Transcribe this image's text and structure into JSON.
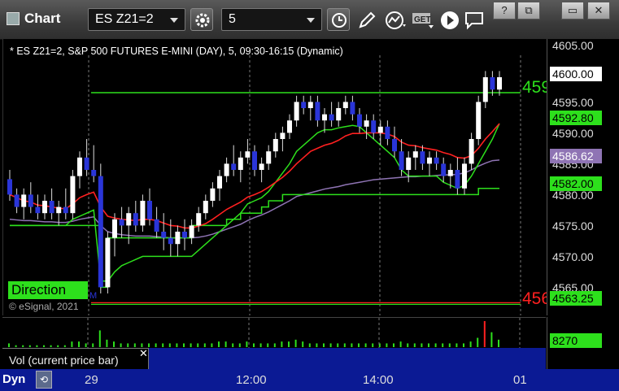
{
  "toolbar": {
    "title": "Chart",
    "symbol": "ES Z21=2",
    "interval": "5",
    "window_buttons": [
      "?",
      "⧉",
      "▭",
      "✕"
    ],
    "icons": [
      "gear-icon",
      "clock-icon",
      "pencil-icon",
      "study-icon",
      "get-icon",
      "play-icon",
      "chat-icon"
    ]
  },
  "chart": {
    "header": "* ES Z21=2, S&P 500 FUTURES E-MINI (DAY), 5, 09:30-16:15 (Dynamic)",
    "copyright": "© eSignal, 2021",
    "direction_label": "Direction",
    "small_marker": "M",
    "green_line_label": "459",
    "red_line_label": "456"
  },
  "price_axis": {
    "ticks": [
      "4605.00",
      "4600.00",
      "4595.00",
      "4590.00",
      "4585.00",
      "4580.00",
      "4575.00",
      "4570.00",
      "4565.00"
    ],
    "tags": [
      {
        "text": "4600.00",
        "bg": "#ffffff",
        "fg": "#000000"
      },
      {
        "text": "4592.80",
        "bg": "#2de01c",
        "fg": "#000000"
      },
      {
        "text": "4586.62",
        "bg": "#8f74b4",
        "fg": "#ffffff"
      },
      {
        "text": "4582.00",
        "bg": "#2de01c",
        "fg": "#000000"
      },
      {
        "text": "4563.25",
        "bg": "#2de01c",
        "fg": "#000000"
      }
    ]
  },
  "volume": {
    "label": "Vol (current price bar)",
    "close_glyph": "✕",
    "value": "8270"
  },
  "time_axis": {
    "ticks": [
      "29",
      "12:00",
      "14:00",
      "01"
    ],
    "dyn_label": "Dyn"
  },
  "colors": {
    "up": "#ffffff",
    "down": "#2a35d8",
    "ema": "#ff2020",
    "band": "#2de01c",
    "vwap": "#8f74b4",
    "level": "#2de01c"
  },
  "chart_data": {
    "type": "candlestick",
    "ylim": [
      4563,
      4606
    ],
    "levels": [
      4597.5,
      4563.5
    ],
    "candles": [
      [
        4583.5,
        4585,
        4580,
        4581
      ],
      [
        4581,
        4582,
        4578,
        4579
      ],
      [
        4579,
        4582,
        4577,
        4581
      ],
      [
        4581,
        4583,
        4578,
        4579
      ],
      [
        4579,
        4581,
        4577,
        4578
      ],
      [
        4578,
        4581,
        4577,
        4580
      ],
      [
        4580,
        4582,
        4577,
        4578
      ],
      [
        4578,
        4580,
        4576,
        4579
      ],
      [
        4579,
        4582,
        4577,
        4578
      ],
      [
        4578,
        4585,
        4577,
        4584
      ],
      [
        4584,
        4588,
        4582,
        4587
      ],
      [
        4587,
        4590,
        4584,
        4585
      ],
      [
        4585,
        4589,
        4583,
        4584
      ],
      [
        4584,
        4586,
        4565,
        4566
      ],
      [
        4566,
        4575,
        4565,
        4574
      ],
      [
        4574,
        4578,
        4571,
        4577
      ],
      [
        4577,
        4579,
        4574,
        4576
      ],
      [
        4576,
        4579,
        4573,
        4578
      ],
      [
        4578,
        4580,
        4575,
        4576
      ],
      [
        4576,
        4581,
        4575,
        4580
      ],
      [
        4580,
        4582,
        4576,
        4577
      ],
      [
        4577,
        4579,
        4574,
        4575
      ],
      [
        4575,
        4578,
        4572,
        4574
      ],
      [
        4574,
        4577,
        4571,
        4573
      ],
      [
        4573,
        4576,
        4571,
        4575
      ],
      [
        4575,
        4577,
        4572,
        4574
      ],
      [
        4574,
        4577,
        4573,
        4576
      ],
      [
        4576,
        4579,
        4575,
        4578
      ],
      [
        4578,
        4581,
        4577,
        4580
      ],
      [
        4580,
        4583,
        4579,
        4582
      ],
      [
        4582,
        4585,
        4580,
        4584
      ],
      [
        4584,
        4587,
        4583,
        4586
      ],
      [
        4586,
        4589,
        4584,
        4585
      ],
      [
        4585,
        4588,
        4583,
        4587
      ],
      [
        4587,
        4590,
        4586,
        4588
      ],
      [
        4588,
        4589,
        4584,
        4585
      ],
      [
        4585,
        4587,
        4583,
        4586
      ],
      [
        4586,
        4589,
        4585,
        4588
      ],
      [
        4588,
        4591,
        4587,
        4590
      ],
      [
        4590,
        4592,
        4588,
        4591
      ],
      [
        4591,
        4594,
        4590,
        4593
      ],
      [
        4593,
        4597,
        4592,
        4596
      ],
      [
        4596,
        4597,
        4594,
        4595
      ],
      [
        4595,
        4597,
        4593,
        4596
      ],
      [
        4596,
        4597,
        4592,
        4593
      ],
      [
        4593,
        4595,
        4591,
        4594
      ],
      [
        4594,
        4596,
        4592,
        4593
      ],
      [
        4593,
        4596,
        4592,
        4595
      ],
      [
        4595,
        4597,
        4594,
        4596
      ],
      [
        4596,
        4597,
        4593,
        4594
      ],
      [
        4594,
        4595,
        4591,
        4592
      ],
      [
        4592,
        4594,
        4590,
        4593
      ],
      [
        4593,
        4594,
        4590,
        4591
      ],
      [
        4591,
        4593,
        4589,
        4592
      ],
      [
        4592,
        4593,
        4589,
        4590
      ],
      [
        4590,
        4592,
        4587,
        4588
      ],
      [
        4588,
        4590,
        4584,
        4585
      ],
      [
        4585,
        4588,
        4583,
        4587
      ],
      [
        4587,
        4589,
        4585,
        4588
      ],
      [
        4588,
        4589,
        4585,
        4586
      ],
      [
        4586,
        4588,
        4584,
        4587
      ],
      [
        4587,
        4588,
        4585,
        4586
      ],
      [
        4586,
        4587,
        4583,
        4584
      ],
      [
        4584,
        4586,
        4582,
        4585
      ],
      [
        4585,
        4587,
        4581,
        4582
      ],
      [
        4582,
        4587,
        4581,
        4586
      ],
      [
        4586,
        4591,
        4585,
        4590
      ],
      [
        4590,
        4597,
        4589,
        4596
      ],
      [
        4596,
        4601,
        4595,
        4600
      ],
      [
        4600,
        4601,
        4597,
        4598
      ],
      [
        4598,
        4601,
        4597,
        4600
      ]
    ],
    "ema": [
      4581,
      4580.5,
      4580,
      4579.8,
      4579.3,
      4579.2,
      4579,
      4578.8,
      4578.7,
      4579.5,
      4580.5,
      4581,
      4581.4,
      4579,
      4577.5,
      4577.2,
      4577,
      4576.9,
      4576.8,
      4577,
      4577,
      4576.8,
      4576.4,
      4576,
      4575.9,
      4575.6,
      4575.6,
      4575.9,
      4576.3,
      4577,
      4577.8,
      4578.6,
      4579.2,
      4579.8,
      4580.6,
      4581,
      4581.5,
      4582.2,
      4583,
      4583.8,
      4584.8,
      4586,
      4587,
      4588,
      4588.5,
      4589,
      4589.3,
      4589.8,
      4590.5,
      4590.9,
      4590.9,
      4591,
      4591,
      4591,
      4590.8,
      4590.4,
      4589.5,
      4589,
      4588.9,
      4588.6,
      4588.4,
      4588.2,
      4587.8,
      4587.5,
      4587,
      4586.9,
      4587.3,
      4588.5,
      4590,
      4591.2,
      4592.5
    ],
    "band": [
      4576,
      4576,
      4576,
      4576,
      4576,
      4576,
      4576,
      4576,
      4576,
      4577,
      4577.5,
      4578,
      4578.5,
      4567,
      4567,
      4568.5,
      4569.5,
      4570,
      4570.5,
      4571,
      4571,
      4571,
      4571,
      4571,
      4571,
      4571,
      4571,
      4572,
      4573,
      4574,
      4575,
      4576,
      4577,
      4578,
      4579.5,
      4580,
      4580.5,
      4581.5,
      4583,
      4584.5,
      4586,
      4588,
      4589,
      4590,
      4591,
      4591.5,
      4591.5,
      4591.8,
      4592,
      4592.2,
      4592,
      4591,
      4590,
      4589,
      4588,
      4587,
      4585,
      4584,
      4584,
      4584,
      4584,
      4584,
      4583,
      4582.5,
      4582,
      4582.5,
      4584,
      4586,
      4588,
      4590,
      4592.5
    ],
    "vwap": [
      4577,
      4576.9,
      4576.8,
      4576.8,
      4576.7,
      4576.6,
      4576.6,
      4576.5,
      4576.5,
      4576.7,
      4577,
      4577.2,
      4577.4,
      4576,
      4575,
      4574.7,
      4574.5,
      4574.4,
      4574.3,
      4574.3,
      4574.3,
      4574.2,
      4574.1,
      4574,
      4574,
      4574,
      4574,
      4574.1,
      4574.3,
      4574.6,
      4575,
      4575.4,
      4575.8,
      4576.2,
      4576.8,
      4577.3,
      4577.7,
      4578.2,
      4578.8,
      4579.4,
      4580,
      4580.7,
      4581,
      4581.3,
      4581.6,
      4581.9,
      4582.1,
      4582.3,
      4582.6,
      4582.8,
      4583,
      4583.2,
      4583.4,
      4583.5,
      4583.6,
      4583.7,
      4583.8,
      4583.9,
      4583.9,
      4584,
      4584,
      4584.1,
      4584.2,
      4584.2,
      4584.3,
      4584.5,
      4585,
      4585.6,
      4586.1,
      4586.5,
      4586.6
    ],
    "support": [
      4576,
      4576,
      4576,
      4576,
      4576,
      4576,
      4576,
      4576,
      4576,
      4576,
      4576,
      4576,
      4576,
      4566,
      4574,
      4574,
      4574,
      4574,
      4574,
      4574,
      4574,
      4574,
      4574,
      4574,
      4574,
      4574,
      4576,
      4576,
      4576,
      4576,
      4576,
      4577,
      4577,
      4578,
      4578,
      4578,
      4579,
      4580,
      4580,
      4581,
      4581,
      4581,
      4581,
      4581,
      4581,
      4581,
      4581,
      4581,
      4581,
      4581,
      4581,
      4581,
      4581,
      4581,
      4581,
      4581,
      4581,
      4581,
      4581,
      4581,
      4581,
      4581,
      4581,
      4581,
      4581,
      4581,
      4581,
      4582,
      4582,
      4582,
      4582
    ],
    "volume": [
      2,
      1,
      1,
      1,
      1,
      1,
      1,
      1,
      1,
      3,
      3,
      2,
      2,
      9,
      4,
      3,
      2,
      2,
      2,
      2,
      2,
      2,
      2,
      2,
      2,
      2,
      2,
      2,
      2,
      2,
      3,
      3,
      2,
      2,
      3,
      2,
      2,
      2,
      2,
      3,
      3,
      4,
      3,
      2,
      2,
      2,
      2,
      2,
      2,
      2,
      2,
      2,
      2,
      2,
      2,
      2,
      3,
      2,
      2,
      2,
      2,
      2,
      2,
      2,
      2,
      2,
      3,
      5,
      14,
      8,
      4
    ]
  }
}
